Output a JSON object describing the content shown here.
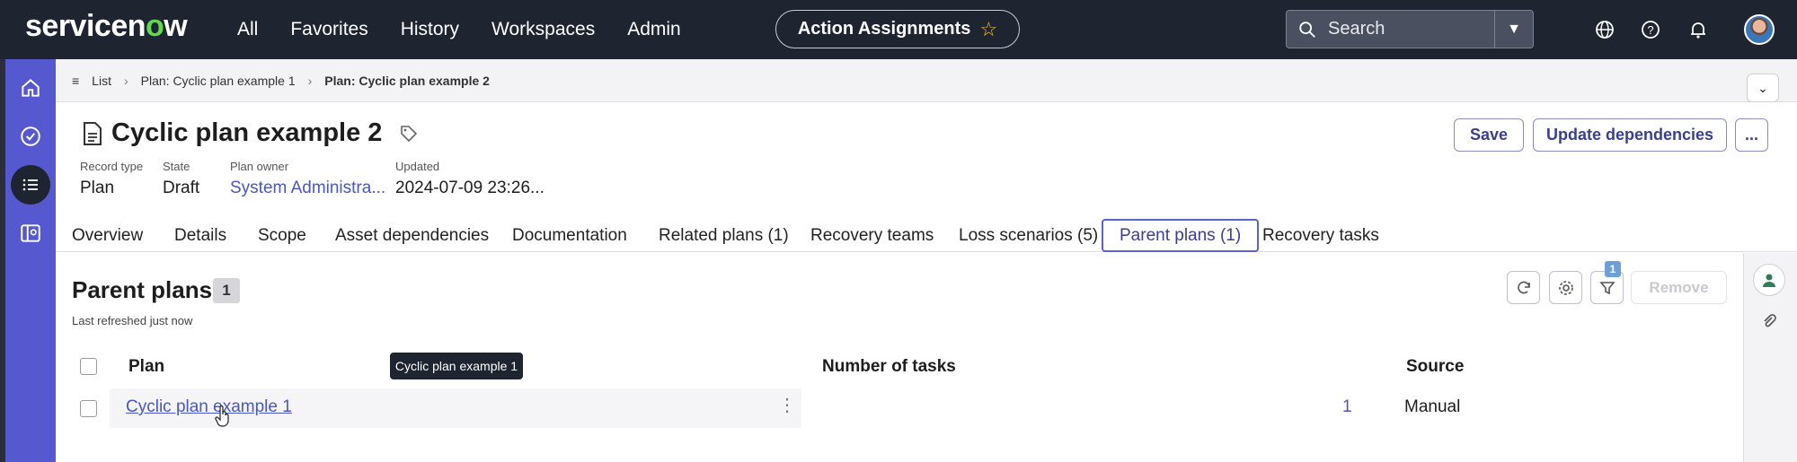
{
  "topnav": {
    "logo_main": "servicen",
    "logo_o": "o",
    "logo_end": "w",
    "links": [
      "All",
      "Favorites",
      "History",
      "Workspaces",
      "Admin"
    ],
    "action_pill": "Action Assignments",
    "search_label": "Search",
    "icons": [
      "globe-icon",
      "help-icon",
      "bell-icon"
    ]
  },
  "rail": {
    "icons": [
      "home-icon",
      "check-circle-icon",
      "list-icon",
      "panel-icon"
    ]
  },
  "breadcrumb": {
    "list": "List",
    "parent": "Plan: Cyclic plan example 1",
    "current": "Plan: Cyclic plan example 2"
  },
  "record": {
    "title": "Cyclic plan example 2",
    "fields": [
      {
        "label": "Record type",
        "value": "Plan"
      },
      {
        "label": "State",
        "value": "Draft"
      },
      {
        "label": "Plan owner",
        "value": "System Administra..."
      },
      {
        "label": "Updated",
        "value": "2024-07-09 23:26..."
      }
    ],
    "buttons": {
      "save": "Save",
      "update": "Update dependencies",
      "more": "..."
    }
  },
  "tabs": [
    "Overview",
    "Details",
    "Scope",
    "Asset dependencies",
    "Documentation",
    "Related plans (1)",
    "Recovery teams",
    "Loss scenarios (5)",
    "Parent plans (1)",
    "Recovery tasks"
  ],
  "active_tab": "Parent plans (1)",
  "list": {
    "title": "Parent plans",
    "count": "1",
    "refreshed": "Last refreshed just now",
    "filter_count": "1",
    "remove_label": "Remove",
    "columns": [
      "Plan",
      "Number of tasks",
      "Source"
    ],
    "rows": [
      {
        "plan": "Cyclic plan example 1",
        "tasks": "1",
        "source": "Manual"
      }
    ],
    "tooltip": "Cyclic plan example 1"
  },
  "colors": {
    "nav_bg": "#1e2430",
    "rail": "#5558cf",
    "accent": "#4a55c8",
    "logo_o": "#62d84e"
  }
}
